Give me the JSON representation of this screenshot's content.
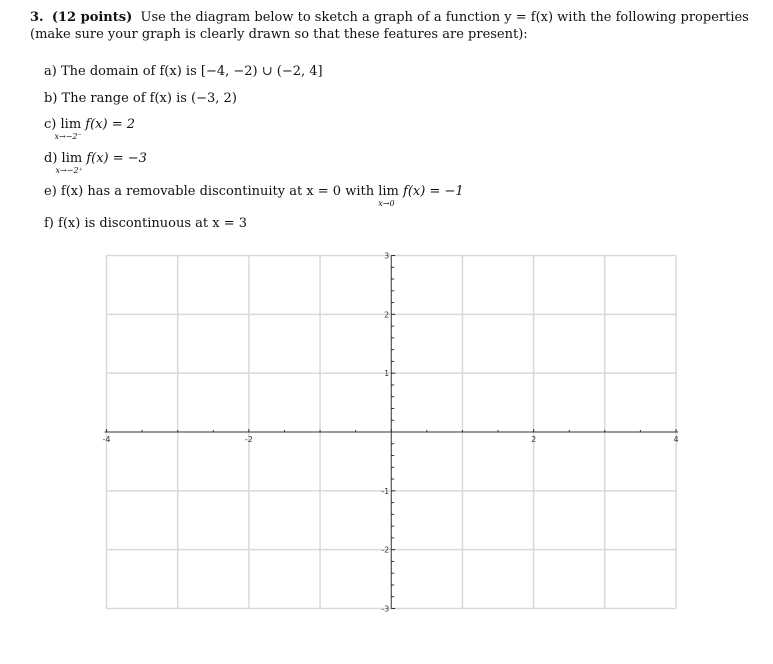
{
  "problem": {
    "number": "3.",
    "points": "(12 points)",
    "text": "Use the diagram below to sketch a graph of a function y = f(x) with the following properties (make sure your graph is clearly drawn so that these features are present):"
  },
  "properties": [
    {
      "label": "a)",
      "text": "The domain of f(x) is [−4, −2) ∪ (−2, 4]"
    },
    {
      "label": "b)",
      "text": "The range of f(x) is (−3, 2)"
    },
    {
      "label": "c)",
      "lim": "lim",
      "sub": "x→−2⁻",
      "text": "f(x) = 2"
    },
    {
      "label": "d)",
      "lim": "lim",
      "sub": "x→−2⁺",
      "text": "f(x) = −3"
    },
    {
      "label": "e)",
      "text": "f(x) has a removable discontinuity at x = 0 with",
      "lim": "lim",
      "sub": "x→0",
      "text2": "f(x) = −1"
    },
    {
      "label": "f)",
      "text": "f(x) is discontinuous at x = 3"
    }
  ],
  "chart_data": {
    "type": "line",
    "title": "",
    "xlabel": "",
    "ylabel": "",
    "xlim": [
      -4,
      4
    ],
    "ylim": [
      -3,
      3
    ],
    "grid": true,
    "grid_x": [
      -4,
      -3,
      -2,
      -1,
      0,
      1,
      2,
      3,
      4
    ],
    "grid_y": [
      -3,
      -2,
      -1,
      0,
      1,
      2,
      3
    ],
    "x_tick_labels": [
      "-4",
      "-2",
      "2",
      "4"
    ],
    "x_tick_values": [
      -4,
      -2,
      2,
      4
    ],
    "y_tick_labels": [
      "3",
      "2",
      "1",
      "-1",
      "-2",
      "-3"
    ],
    "y_tick_values": [
      3,
      2,
      1,
      -1,
      -2,
      -3
    ],
    "series": []
  }
}
